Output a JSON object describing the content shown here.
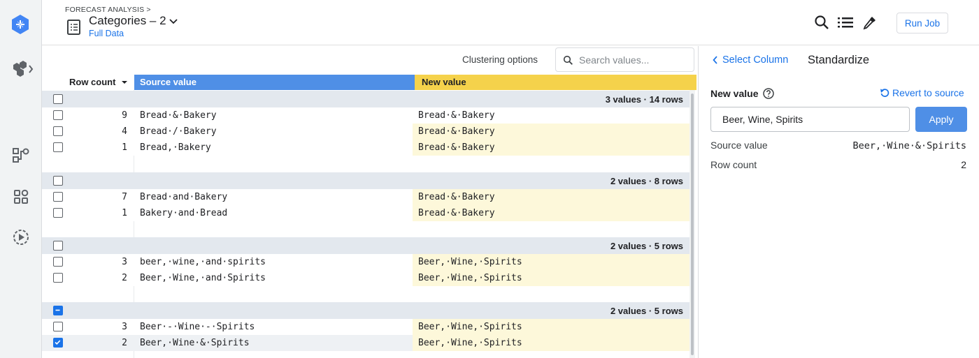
{
  "header": {
    "breadcrumb": "FORECAST ANALYSIS >",
    "title": "Categories – 2",
    "subtitle": "Full Data",
    "run_job_label": "Run Job"
  },
  "rail": {
    "icons": [
      "product-logo-icon",
      "objects-expand-icon",
      "flow-icon",
      "apps-icon",
      "jobs-icon"
    ]
  },
  "toolbar": {
    "clustering_label": "Clustering options",
    "search_placeholder": "Search values..."
  },
  "columns": {
    "row_count": "Row count",
    "source_value": "Source value",
    "new_value": "New value"
  },
  "groups": [
    {
      "summary": "3 values · 14 rows",
      "rows": [
        {
          "count": "9",
          "source": "Bread·&·Bakery",
          "new": "Bread·&·Bakery",
          "changed": false,
          "checked": false
        },
        {
          "count": "4",
          "source": "Bread·/·Bakery",
          "new": "Bread·&·Bakery",
          "changed": true,
          "checked": false
        },
        {
          "count": "1",
          "source": "Bread,·Bakery",
          "new": "Bread·&·Bakery",
          "changed": true,
          "checked": false
        }
      ]
    },
    {
      "summary": "2 values · 8 rows",
      "rows": [
        {
          "count": "7",
          "source": "Bread·and·Bakery",
          "new": "Bread·&·Bakery",
          "changed": true,
          "checked": false
        },
        {
          "count": "1",
          "source": "Bakery·and·Bread",
          "new": "Bread·&·Bakery",
          "changed": true,
          "checked": false
        }
      ]
    },
    {
      "summary": "2 values · 5 rows",
      "rows": [
        {
          "count": "3",
          "source": "beer,·wine,·and·spirits",
          "new": "Beer,·Wine,·Spirits",
          "changed": true,
          "checked": false
        },
        {
          "count": "2",
          "source": "Beer,·Wine,·and·Spirits",
          "new": "Beer,·Wine,·Spirits",
          "changed": true,
          "checked": false
        }
      ]
    },
    {
      "summary": "2 values · 5 rows",
      "partial": true,
      "rows": [
        {
          "count": "3",
          "source": "Beer·-·Wine·-·Spirits",
          "new": "Beer,·Wine,·Spirits",
          "changed": true,
          "checked": false
        },
        {
          "count": "2",
          "source": "Beer,·Wine·&·Spirits",
          "new": "Beer,·Wine,·Spirits",
          "changed": true,
          "checked": true
        }
      ]
    }
  ],
  "panel": {
    "back_label": "Select Column",
    "title": "Standardize",
    "new_value_label": "New value",
    "revert_label": "Revert to source",
    "new_value_input": "Beer, Wine, Spirits",
    "apply_label": "Apply",
    "source_value_label": "Source value",
    "source_value": "Beer,·Wine·&·Spirits",
    "row_count_label": "Row count",
    "row_count": "2"
  },
  "colors": {
    "accent": "#1a73e8",
    "source_header": "#4f8fe6",
    "new_header": "#f5d24b",
    "changed_cell": "#fdf8da",
    "group_row": "#e3e8ee"
  }
}
